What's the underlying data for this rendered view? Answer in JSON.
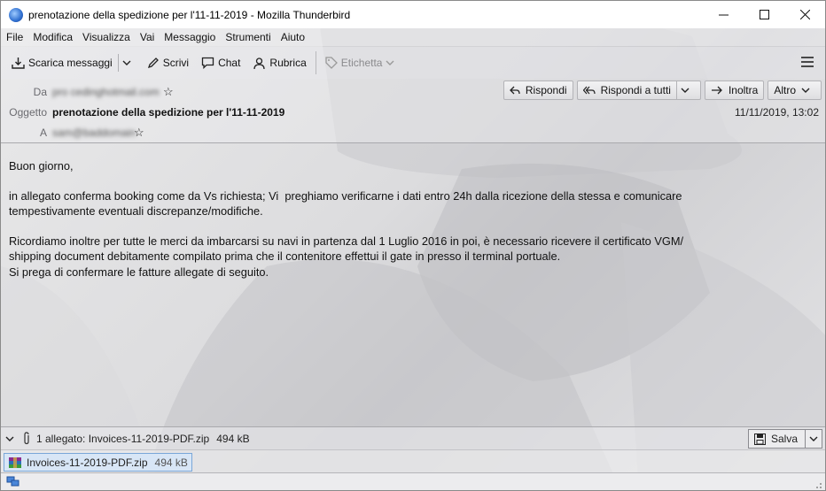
{
  "window": {
    "title": "prenotazione della spedizione per l'11-11-2019 - Mozilla Thunderbird",
    "controls": [
      "minimize",
      "maximize",
      "close"
    ]
  },
  "menu": [
    "File",
    "Modifica",
    "Visualizza",
    "Vai",
    "Messaggio",
    "Strumenti",
    "Aiuto"
  ],
  "toolbar": {
    "get_messages": "Scarica messaggi",
    "write": "Scrivi",
    "chat": "Chat",
    "address_book": "Rubrica",
    "tag": "Etichetta"
  },
  "header": {
    "from_label": "Da",
    "from_value": "pro   cedinghotmail.com",
    "subject_label": "Oggetto",
    "subject_value": "prenotazione della spedizione per l'11-11-2019",
    "to_label": "A",
    "to_value": "sam@baddomain",
    "date": "11/11/2019, 13:02",
    "reply": "Rispondi",
    "reply_all": "Rispondi a tutti",
    "forward": "Inoltra",
    "more": "Altro"
  },
  "body": {
    "greeting": "Buon giorno,",
    "line1": "in allegato conferma booking come da Vs richiesta; Vi  preghiamo verificarne i dati entro 24h dalla ricezione della stessa e comunicare",
    "line2": "tempestivamente eventuali discrepanze/modifiche.",
    "line3": "Ricordiamo inoltre per tutte le merci da imbarcarsi su navi in partenza dal 1 Luglio 2016 in poi, è necessario ricevere il certificato VGM/",
    "line4": "shipping document debitamente compilato prima che il contenitore effettui il gate in presso il terminal portuale.",
    "line5": "Si prega di confermare le fatture allegate di seguito."
  },
  "attachments": {
    "summary": "1 allegato: Invoices-11-2019-PDF.zip",
    "summary_size": "494 kB",
    "save_label": "Salva",
    "items": [
      {
        "name": "Invoices-11-2019-PDF.zip",
        "size": "494 kB"
      }
    ]
  }
}
